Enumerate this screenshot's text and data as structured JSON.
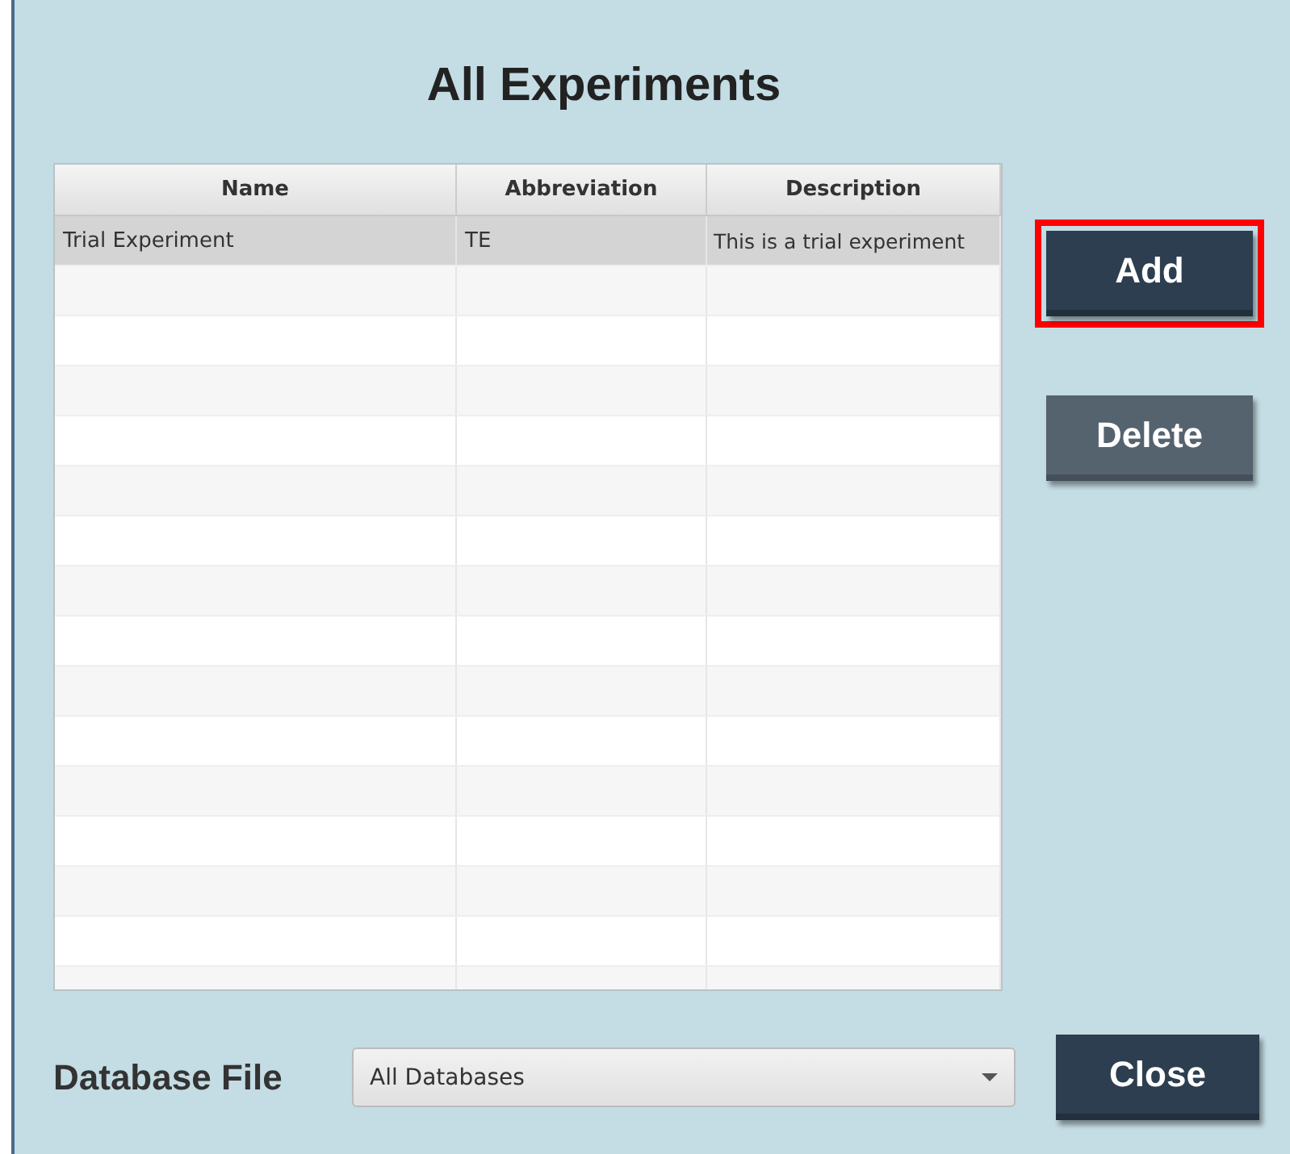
{
  "title": "All Experiments",
  "table": {
    "columns": [
      "Name",
      "Abbreviation",
      "Description"
    ],
    "rows": [
      {
        "cells": [
          "Trial Experiment",
          "TE",
          "This is a trial experiment"
        ],
        "selected": true
      }
    ]
  },
  "side_buttons": [
    {
      "label": "Add",
      "focused": true,
      "disabled": false
    },
    {
      "label": "Delete",
      "focused": false,
      "disabled": true
    }
  ],
  "database_file": {
    "label": "Database File",
    "value": "All Databases"
  },
  "close_button": {
    "label": "Close"
  }
}
